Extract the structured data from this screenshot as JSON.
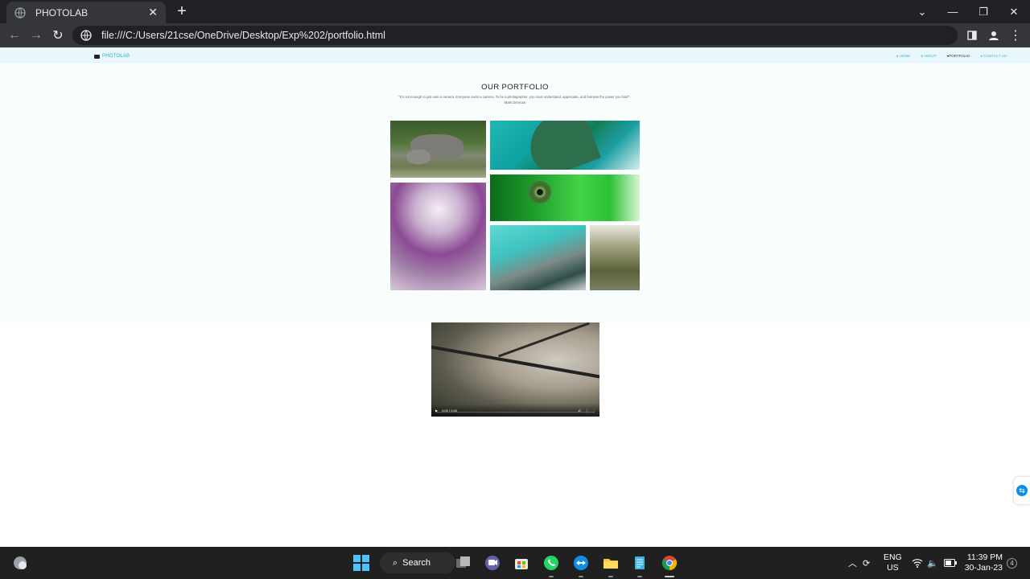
{
  "browser": {
    "tab_title": "PHOTOLAB",
    "new_tab": "+",
    "url": "file:///C:/Users/21cse/OneDrive/Desktop/Exp%202/portfolio.html"
  },
  "site": {
    "brand": "PHOTOLAB",
    "nav": [
      "● HOME",
      "● ABOUT",
      "●PORTFOLIO",
      "● CONTACT US"
    ],
    "active_nav_index": 2,
    "accent_color": "#2ba9c6",
    "section_title": "OUR PORTFOLIO",
    "quote": "\"It's not enough to just own a camera. Everyone owns a camera. To be a photographer, you must understand, appreciate, and harness the power you hold\" -",
    "author": "Mark Denman",
    "video_time": "0:00 / 0:40"
  },
  "taskbar": {
    "search_label": "Search",
    "lang_top": "ENG",
    "lang_bottom": "US",
    "time": "11:39 PM",
    "date": "30-Jan-23",
    "notification_count": "4"
  }
}
